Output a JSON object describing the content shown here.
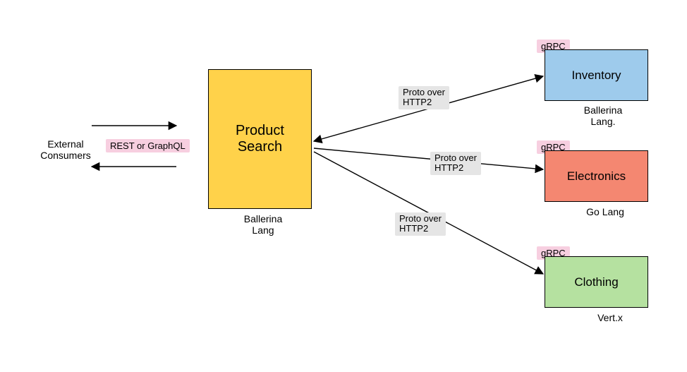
{
  "external": {
    "label": "External\nConsumers"
  },
  "api_tag": "REST or GraphQL",
  "main": {
    "title": "Product\nSearch",
    "caption": "Ballerina\nLang"
  },
  "edges": {
    "e1": "Proto over\nHTTP2",
    "e2": "Proto over\nHTTP2",
    "e3": "Proto over\nHTTP2"
  },
  "services": {
    "inventory": {
      "proto": "gRPC",
      "title": "Inventory",
      "caption": "Ballerina\nLang."
    },
    "electronics": {
      "proto": "gRPC",
      "title": "Electronics",
      "caption": "Go Lang"
    },
    "clothing": {
      "proto": "gRPC",
      "title": "Clothing",
      "caption": "Vert.x"
    }
  }
}
